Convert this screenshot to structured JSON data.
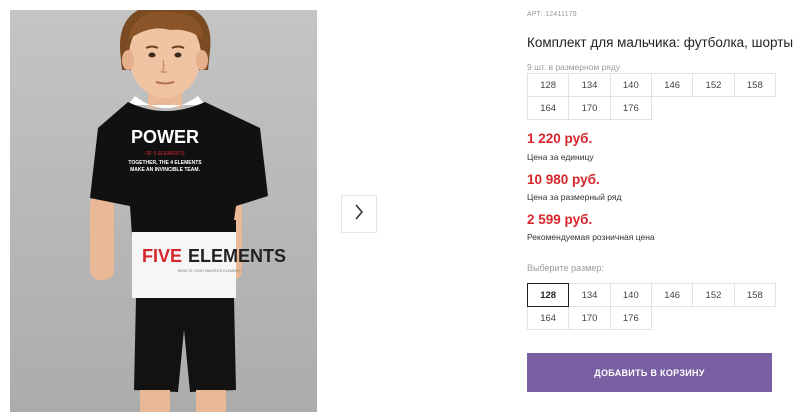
{
  "product": {
    "art": "АРТ: 12411179",
    "title": "Комплект для мальчика: футболка, шорты",
    "size_row_label": "9 шт. в размерном ряду",
    "size_row": [
      "128",
      "134",
      "140",
      "146",
      "152",
      "158",
      "164",
      "170",
      "176"
    ]
  },
  "prices": {
    "unit_price": "1 220 руб.",
    "unit_note": "Цена за единицу",
    "row_price": "10 980 руб.",
    "row_note": "Цена за размерный ряд",
    "retail_price": "2 599 руб.",
    "retail_note": "Рекомендуемая розничная цена"
  },
  "size_select": {
    "label": "Выберите размер:",
    "sizes": [
      "128",
      "134",
      "140",
      "146",
      "152",
      "158",
      "164",
      "170",
      "176"
    ],
    "selected": "128"
  },
  "cart": {
    "add_label": "ДОБАВИТЬ В КОРЗИНУ"
  },
  "shirt_print": {
    "line1": "POWER",
    "line2": "OF 5 ELEMENTS",
    "line3": "TOGETHER, THE 4 ELEMENTS",
    "line4": "MAKE AN INVINCIBLE TEAM.",
    "band_part1": "FIVE",
    "band_part2": "ELEMENTS",
    "band_small": "WHAT IS YOUR FAVORITE ELEMENT?"
  },
  "colors": {
    "price_red": "#d6262c",
    "button_purple": "#7b5fa3",
    "photo_bg": "#b9b9b9"
  },
  "icons": {
    "next": "chevron-right-icon"
  }
}
